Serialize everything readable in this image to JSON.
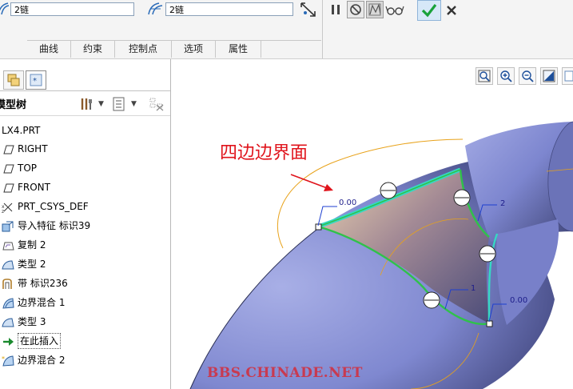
{
  "dashboard": {
    "chain_field_1": "2链",
    "chain_field_2": "2链",
    "tabs": [
      "曲线",
      "约束",
      "控制点",
      "选项",
      "属性"
    ]
  },
  "model_tree": {
    "title": "模型树",
    "items": [
      {
        "label": "LX4.PRT",
        "icon": "part-icon"
      },
      {
        "label": "RIGHT",
        "icon": "datum-plane-icon"
      },
      {
        "label": "TOP",
        "icon": "datum-plane-icon"
      },
      {
        "label": "FRONT",
        "icon": "datum-plane-icon"
      },
      {
        "label": "PRT_CSYS_DEF",
        "icon": "coordinate-system-icon"
      },
      {
        "label": "导入特征 标识39",
        "icon": "import-feature-icon"
      },
      {
        "label": "复制 2",
        "icon": "copy-surface-icon"
      },
      {
        "label": "类型 2",
        "icon": "surface-icon"
      },
      {
        "label": "带 标识236",
        "icon": "ribbon-icon"
      },
      {
        "label": "边界混合 1",
        "icon": "boundary-blend-icon"
      },
      {
        "label": "类型 3",
        "icon": "surface-icon"
      },
      {
        "label": "在此插入",
        "icon": "insert-here-arrow-icon"
      },
      {
        "label": "边界混合 2",
        "icon": "boundary-blend-active-icon"
      }
    ]
  },
  "viewport": {
    "annotation": "四边边界面",
    "labels": {
      "val_top": "0.00",
      "val_right": "0.00",
      "chain_2": "2",
      "chain_1": "1"
    },
    "watermark": "BBS.CHINADE.NET"
  },
  "colors": {
    "surface": "#7d86cf",
    "boundary_green": "#2fc24a",
    "boundary_cyan": "#37d7c4",
    "annotation_red": "#e0141c",
    "curve_orange": "#e8a21a",
    "blend_surface": "#e9c79a",
    "watermark": "#c83a50"
  }
}
